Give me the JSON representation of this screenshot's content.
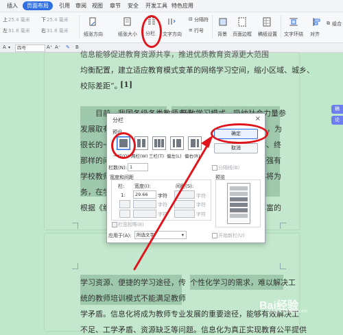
{
  "menu": {
    "tabs": [
      "插入",
      "页面布局",
      "引用",
      "审阅",
      "视图",
      "章节",
      "安全",
      "开发工具",
      "特色应用"
    ],
    "active_index": 1
  },
  "ribbon": {
    "margin_top_label": "上",
    "margin_top_value": "25.4 毫米",
    "margin_bottom_label": "下",
    "margin_bottom_value": "25.4 毫米",
    "margin_left_label": "左",
    "margin_left_value": "31.8 毫米",
    "margin_right_label": "右",
    "margin_right_value": "31.8 毫米",
    "paper_orientation": "纸张方向",
    "paper_size": "纸张大小",
    "columns": "分栏",
    "text_direction": "文字方向",
    "break": "分隔符",
    "line_number": "行号",
    "background": "背景",
    "page_border": "页面边框",
    "manuscript": "稿纸设置",
    "text_wrap": "文字环绕",
    "align": "对齐",
    "combine": "组合"
  },
  "format_bar": {
    "style_value": "四号"
  },
  "document": {
    "page1_lines": [
      "均衡配置，建立适应教育模式变革的网络学习空间，缩小区域、城乡、",
      "校际差距”。",
      "目前，我国各级各类教师专业",
      "发展取有",
      "很长的一",
      "那样的问",
      "学校教师",
      "务，在学",
      "根据《纲"
    ],
    "ref_mark": "[1]",
    "right_col_lines": [
      "开放学习模式，吸纳社会力量参",
      "，为",
      "学、终",
      "供强有",
      "必将为",
      "丰富的"
    ],
    "page2_lines": [
      "学习资源、便捷的学习途径，传",
      "个性化学习的需求，难以解决工",
      "统的教师培训模式不能满足教师",
      "学矛盾。信息化将成为教师专业发展的重要途径，能够有效解决工",
      "不足、工学矛盾、资源缺乏等问题。信息化为真正实现教育公平提供"
    ]
  },
  "side_buttons": [
    "稿",
    "论"
  ],
  "dialog": {
    "title": "分栏",
    "presets_label": "预设",
    "presets": [
      "一栏(O)",
      "两栏(W)",
      "三栏(T)",
      "偏左(L)",
      "偏右(R)"
    ],
    "selected_preset": 0,
    "ok_label": "确定",
    "cancel_label": "取消",
    "columns_count_label": "栏数(N):",
    "columns_count_value": "1",
    "separator_label": "分隔线(B)",
    "width_spacing_label": "宽度和间距",
    "col_header": "栏:",
    "width_header": "宽度(I):",
    "spacing_header": "间距(S):",
    "row1_col": "1:",
    "row1_width": "29.66",
    "unit": "字符",
    "equal_width_label": "栏宽相等(E)",
    "preview_label": "预览",
    "apply_to_label": "应用于(A):",
    "apply_to_value": "所选文字",
    "new_column_label": "开始新栏(U)"
  },
  "watermark": {
    "text": "Bai经验",
    "subtext": "jingyan.baidu.com"
  },
  "colors": {
    "accent": "#2f6fe0",
    "annotation": "#e0141b",
    "page": "#c4e8cd"
  }
}
